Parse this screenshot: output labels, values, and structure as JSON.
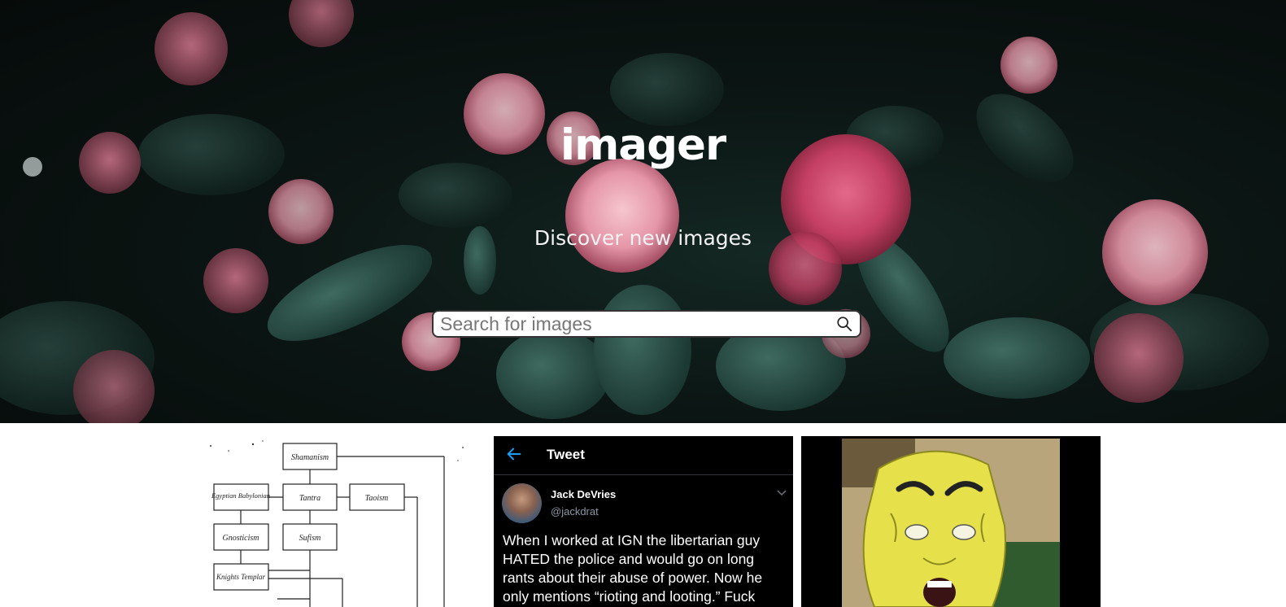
{
  "hero": {
    "title": "imager",
    "subtitle": "Discover new images"
  },
  "search": {
    "placeholder": "Search for images",
    "icon": "search-icon"
  },
  "cards": {
    "diagram": {
      "boxes": [
        "Shamanism",
        "Egyptian Babylonian",
        "Tantra",
        "Taoism",
        "Gnosticism",
        "Sufism",
        "Knights Templar"
      ]
    },
    "tweet": {
      "header": "Tweet",
      "name": "Jack DeVries",
      "handle": "@jackdrat",
      "body": "When I worked at IGN the libertarian guy HATED the police and would go on long rants about their abuse of power. Now he only mentions “rioting and looting.” Fuck"
    },
    "meme": {}
  },
  "colors": {
    "hero_bg": "#0b1513",
    "tweet_bg": "#000000",
    "tweet_accent": "#1d9bf0"
  }
}
